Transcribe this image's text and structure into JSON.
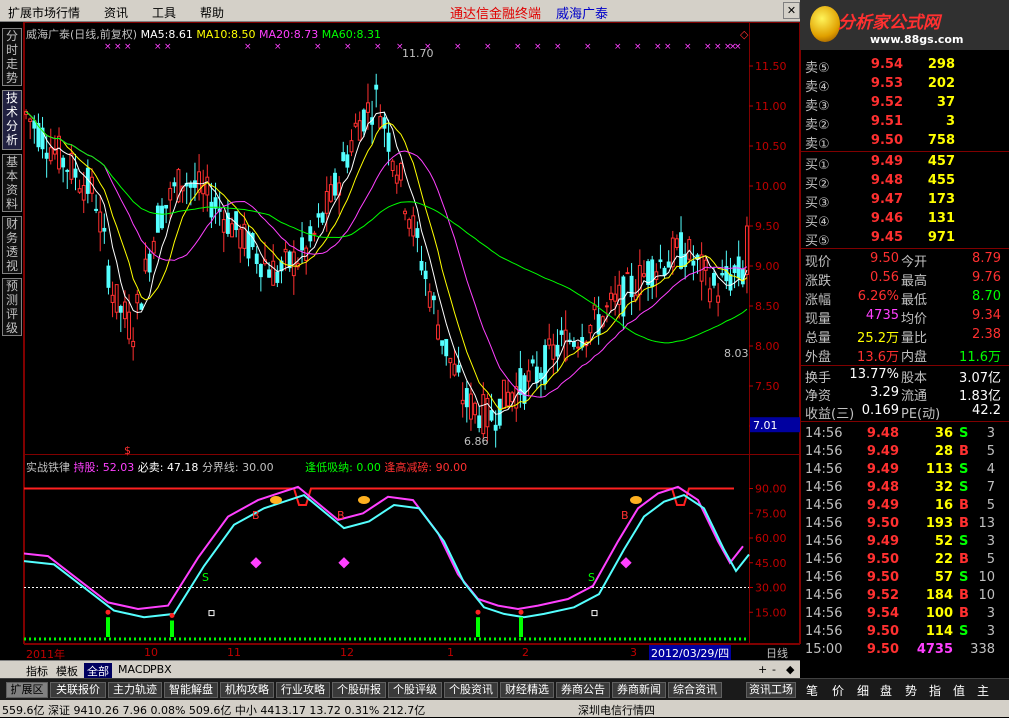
{
  "menu": {
    "items": [
      "扩展市场行情",
      "资讯",
      "工具",
      "帮助"
    ],
    "ad_red": "通达信金融终端",
    "ad_blue": "威海广泰"
  },
  "logo": {
    "text": "分析家公式网",
    "url": "www.88gs.com",
    "overlay": "威海广泰"
  },
  "left_tabs": [
    "分时走势",
    "技术分析",
    "基本资料",
    "财务透视",
    "预测评级"
  ],
  "price_chart": {
    "stock": "威海广泰(日线,前复权)",
    "ma": [
      {
        "label": "MA5:",
        "value": "8.61",
        "color": "#ffffff"
      },
      {
        "label": "MA10:",
        "value": "8.50",
        "color": "#ffff00"
      },
      {
        "label": "MA20:",
        "value": "8.73",
        "color": "#ff40ff"
      },
      {
        "label": "MA60:",
        "value": "8.31",
        "color": "#00ff00"
      }
    ],
    "ylabels": [
      "11.50",
      "11.00",
      "10.50",
      "10.00",
      "9.50",
      "9.00",
      "8.50",
      "8.00",
      "7.50",
      "7.00"
    ],
    "current_price_tag": "7.01",
    "high_marker": "11.70",
    "low_marker": "6.86",
    "right_marker": "8.03",
    "marker_s": "$",
    "marker_diamond": "◇"
  },
  "indicator": {
    "name": "实战铁律",
    "hold_label": "持股:",
    "hold_value": "52.03",
    "sell_label": "必卖:",
    "sell_value": "47.18",
    "boundary_label": "分界线:",
    "boundary_value": "30.00",
    "low_label": "逢低吸纳:",
    "low_value": "0.00",
    "high_label": "逢高减磅:",
    "high_value": "90.00",
    "ylabels": [
      "90.00",
      "75.00",
      "60.00",
      "45.00",
      "30.00",
      "15.00"
    ],
    "marker_b": "B",
    "marker_s": "S"
  },
  "chart_data": {
    "type": "candlestick",
    "ylim": [
      6.8,
      11.8
    ],
    "x_labels": [
      "2011年",
      "10",
      "11",
      "12",
      "1",
      "2",
      "3"
    ],
    "selected_date": "2012/03/29/四",
    "period_label": "日线",
    "period_buttons": [
      "+",
      "-",
      "◆"
    ],
    "high": 11.7,
    "low": 6.86,
    "indicator_ylim": [
      0,
      100
    ],
    "indicator_levels": [
      90,
      30
    ]
  },
  "bottom_tabs": [
    "指标",
    "模板",
    "全部",
    "MACD",
    "PBX"
  ],
  "bottom_selected": "全部",
  "func_buttons": [
    "扩展区",
    "关联报价",
    "主力轨迹",
    "智能解盘",
    "机构攻略",
    "行业攻略",
    "个股研报",
    "个股评级",
    "个股资讯",
    "财经精选",
    "券商公告",
    "券商新闻",
    "综合资讯",
    "资讯工场"
  ],
  "right_tabs": [
    "笔",
    "价",
    "细",
    "盘",
    "势",
    "指",
    "值",
    "主"
  ],
  "quotes": {
    "asks": [
      {
        "label": "卖⑤",
        "price": "9.54",
        "vol": "298"
      },
      {
        "label": "卖④",
        "price": "9.53",
        "vol": "202"
      },
      {
        "label": "卖③",
        "price": "9.52",
        "vol": "37"
      },
      {
        "label": "卖②",
        "price": "9.51",
        "vol": "3"
      },
      {
        "label": "卖①",
        "price": "9.50",
        "vol": "758"
      }
    ],
    "bids": [
      {
        "label": "买①",
        "price": "9.49",
        "vol": "457"
      },
      {
        "label": "买②",
        "price": "9.48",
        "vol": "455"
      },
      {
        "label": "买③",
        "price": "9.47",
        "vol": "173"
      },
      {
        "label": "买④",
        "price": "9.46",
        "vol": "131"
      },
      {
        "label": "买⑤",
        "price": "9.45",
        "vol": "971"
      }
    ],
    "stats": [
      {
        "l1": "现价",
        "v1": "9.50",
        "c1": "#ff3030",
        "l2": "今开",
        "v2": "8.79",
        "c2": "#ff3030"
      },
      {
        "l1": "涨跌",
        "v1": "0.56",
        "c1": "#ff3030",
        "l2": "最高",
        "v2": "9.76",
        "c2": "#ff3030"
      },
      {
        "l1": "涨幅",
        "v1": "6.26%",
        "c1": "#ff3030",
        "l2": "最低",
        "v2": "8.70",
        "c2": "#00ff00"
      },
      {
        "l1": "现量",
        "v1": "4735",
        "c1": "#ff40ff",
        "l2": "均价",
        "v2": "9.34",
        "c2": "#ff3030"
      },
      {
        "l1": "总量",
        "v1": "25.2万",
        "c1": "#ffff00",
        "l2": "量比",
        "v2": "2.38",
        "c2": "#ff3030"
      },
      {
        "l1": "外盘",
        "v1": "13.6万",
        "c1": "#ff3030",
        "l2": "内盘",
        "v2": "11.6万",
        "c2": "#00ff00"
      }
    ],
    "stats2": [
      {
        "l1": "换手",
        "v1": "13.77%",
        "c1": "#ffffff",
        "l2": "股本",
        "v2": "3.07亿",
        "c2": "#ffffff"
      },
      {
        "l1": "净资",
        "v1": "3.29",
        "c1": "#ffffff",
        "l2": "流通",
        "v2": "1.83亿",
        "c2": "#ffffff"
      },
      {
        "l1": "收益(三)",
        "v1": "0.169",
        "c1": "#ffffff",
        "l2": "PE(动)",
        "v2": "42.2",
        "c2": "#ffffff"
      }
    ],
    "ticks": [
      {
        "time": "14:56",
        "price": "9.48",
        "vol": "36",
        "bs": "S",
        "n": "3"
      },
      {
        "time": "14:56",
        "price": "9.49",
        "vol": "28",
        "bs": "B",
        "n": "5"
      },
      {
        "time": "14:56",
        "price": "9.49",
        "vol": "113",
        "bs": "S",
        "n": "4"
      },
      {
        "time": "14:56",
        "price": "9.48",
        "vol": "32",
        "bs": "S",
        "n": "7"
      },
      {
        "time": "14:56",
        "price": "9.49",
        "vol": "16",
        "bs": "B",
        "n": "5"
      },
      {
        "time": "14:56",
        "price": "9.50",
        "vol": "193",
        "bs": "B",
        "n": "13"
      },
      {
        "time": "14:56",
        "price": "9.49",
        "vol": "52",
        "bs": "S",
        "n": "3"
      },
      {
        "time": "14:56",
        "price": "9.50",
        "vol": "22",
        "bs": "B",
        "n": "5"
      },
      {
        "time": "14:56",
        "price": "9.50",
        "vol": "57",
        "bs": "S",
        "n": "10"
      },
      {
        "time": "14:56",
        "price": "9.52",
        "vol": "184",
        "bs": "B",
        "n": "10"
      },
      {
        "time": "14:56",
        "price": "9.54",
        "vol": "100",
        "bs": "B",
        "n": "3"
      },
      {
        "time": "14:56",
        "price": "9.50",
        "vol": "114",
        "bs": "S",
        "n": "3"
      },
      {
        "time": "15:00",
        "price": "9.50",
        "vol": "4735",
        "bs": "",
        "n": "338"
      }
    ]
  },
  "status": {
    "text": "559.6亿 深证 9410.26  7.96  0.08% 509.6亿 中小 4413.17  13.72  0.31% 212.7亿",
    "right": "深圳电信行情四"
  }
}
